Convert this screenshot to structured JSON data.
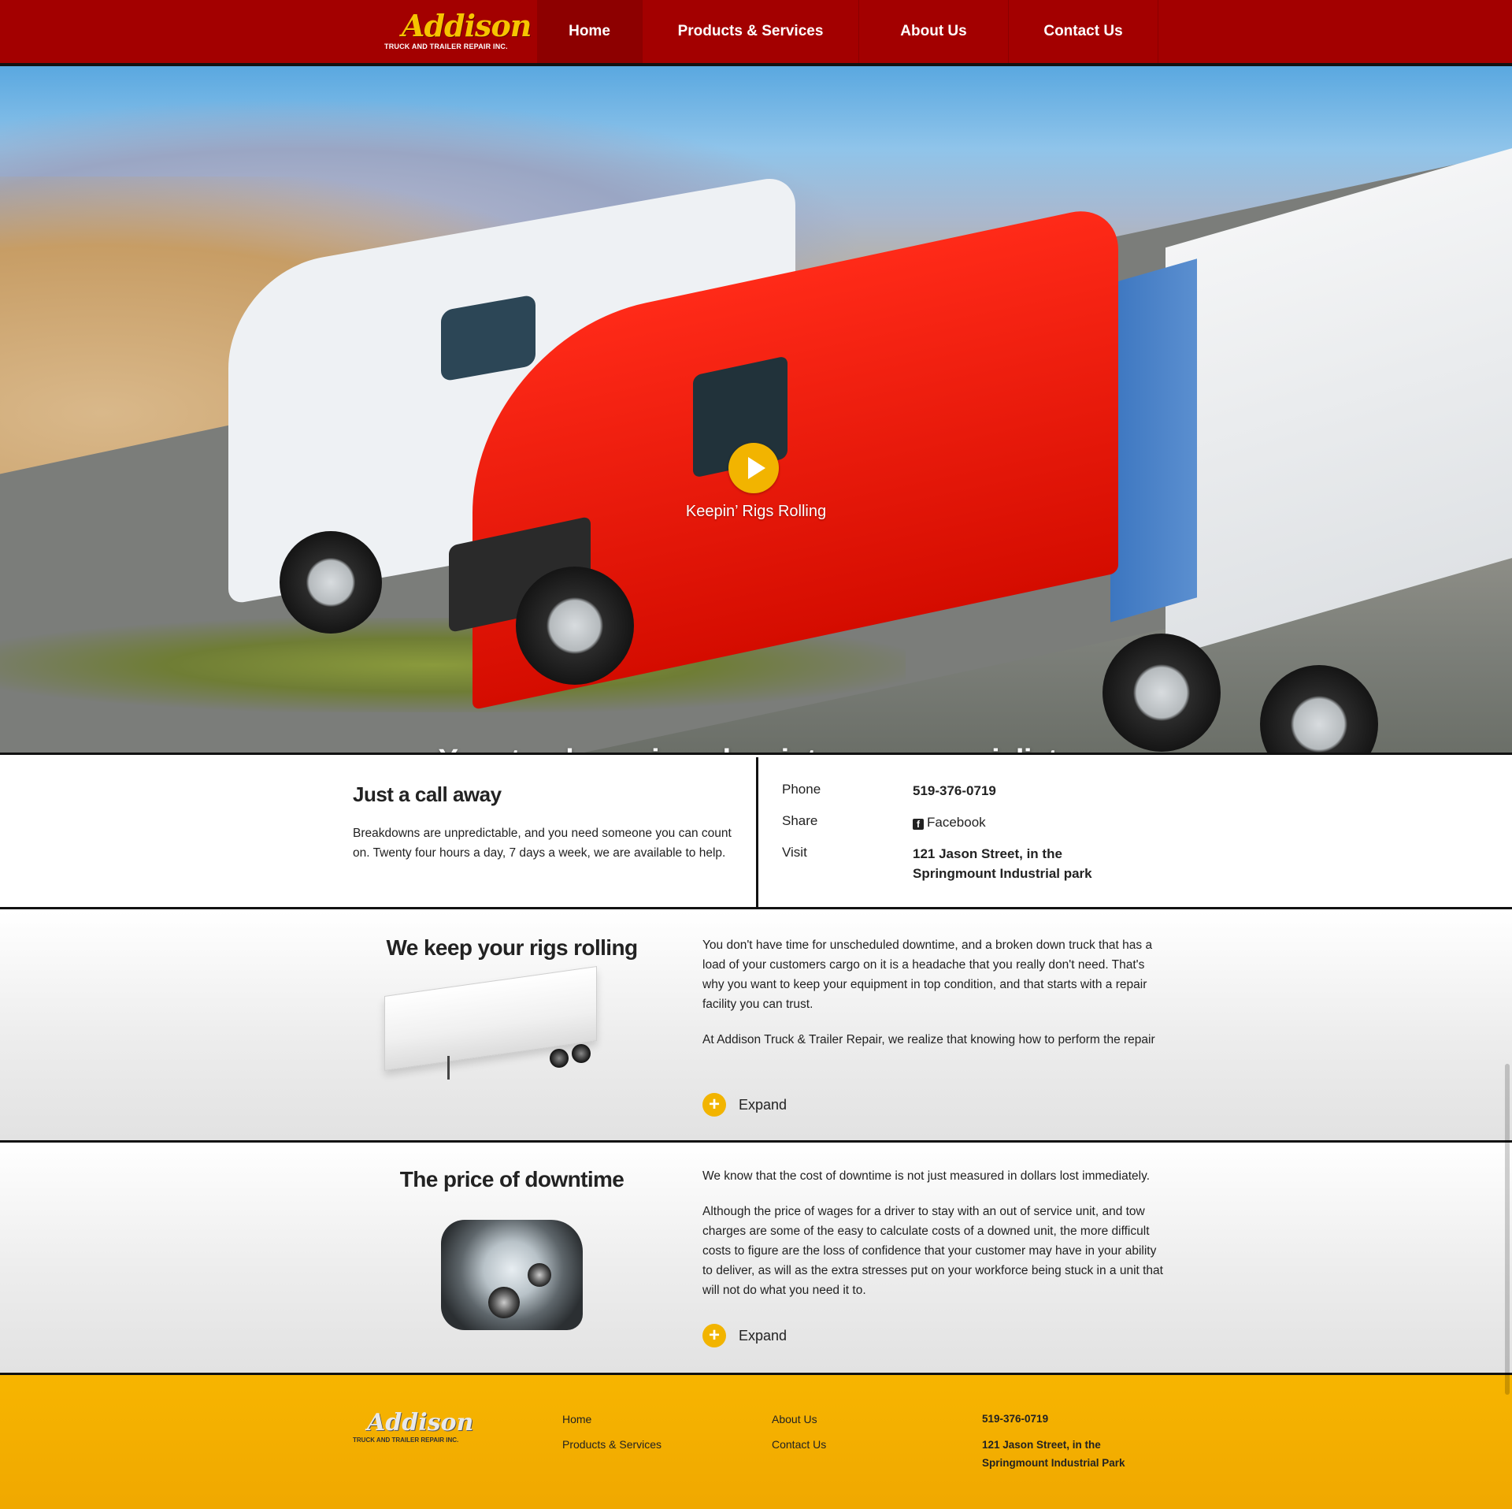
{
  "nav": {
    "logo_script": "Addison",
    "logo_sub": "TRUCK AND TRAILER REPAIR INC.",
    "items": [
      {
        "label": "Home",
        "active": true
      },
      {
        "label": "Products & Services"
      },
      {
        "label": "About Us"
      },
      {
        "label": "Contact Us"
      }
    ]
  },
  "hero": {
    "video_label": "Keepin’ Rigs Rolling",
    "tagline": "Your truck repair and maintenance specialists",
    "play_icon": "play-icon"
  },
  "call": {
    "title": "Just a call away",
    "text": "Breakdowns are unpredictable, and you need someone you can count on. Twenty four hours a day, 7 days a week, we are available to help.",
    "phone_label": "Phone",
    "phone_value": "519-376-0719",
    "share_label": "Share",
    "share_value": "Facebook",
    "visit_label": "Visit",
    "visit_line1": "121 Jason Street, in the",
    "visit_line2": "Springmount Industrial park"
  },
  "sections": [
    {
      "title": "We keep your rigs rolling",
      "paragraphs": [
        "You don't have time for unscheduled downtime, and a broken down truck that has a load of your customers cargo on it is a headache that you really don't need. That's why you want to keep your equipment in top condition, and that starts with a repair facility you can trust.",
        "At Addison Truck & Trailer Repair, we realize that knowing how to perform the repair is important, but preventing that repair, or spotting a problem before it leaves you on the side of the road is top priority, and that requires a maintenance"
      ],
      "expand_label": "Expand"
    },
    {
      "title": "The price of downtime",
      "paragraphs": [
        "We know that the cost of downtime is not just measured in dollars lost immediately.",
        "Although the price of wages for a driver to stay with an out of service unit, and tow charges are some of the easy to calculate costs of a downed unit, the more difficult costs to figure are the loss of confidence that your customer may have in your ability to deliver, as will as the extra stresses put on your workforce being stuck in a unit that will not do what you need it to."
      ],
      "expand_label": "Expand"
    }
  ],
  "footer": {
    "logo_script": "Addison",
    "logo_sub": "TRUCK AND TRAILER REPAIR INC.",
    "links": [
      "Home",
      "Products & Services",
      "About Us",
      "Contact Us"
    ],
    "phone": "519-376-0719",
    "address_line1": "121 Jason Street, in the",
    "address_line2": "Springmount Industrial Park"
  },
  "colors": {
    "nav_red": "#a30000",
    "accent_yellow": "#f2b400",
    "footer_yellow": "#f7b500"
  }
}
